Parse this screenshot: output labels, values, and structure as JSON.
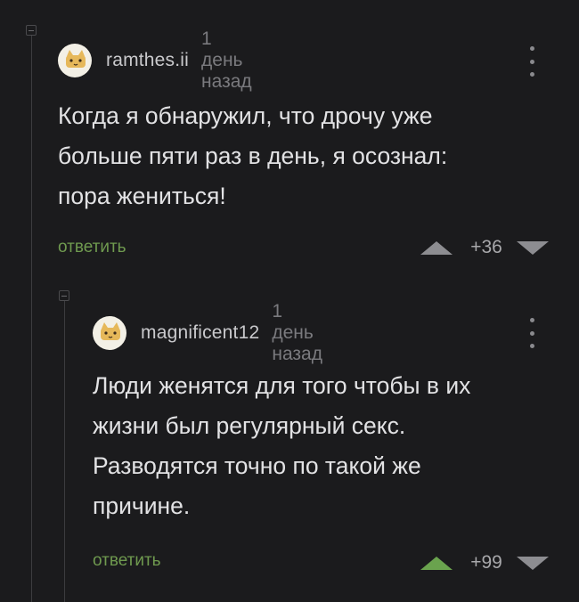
{
  "comments": [
    {
      "username": "ramthes.ii",
      "time": "1 день назад",
      "text_lines": [
        "Когда я обнаружил, что дрочу уже",
        "больше пяти раз в день, я осознал:",
        "пора жениться!"
      ],
      "reply_label": "ответить",
      "score": "+36",
      "voted_up": false,
      "avatar_icon": "cat-face-icon"
    },
    {
      "username": "magnificent12",
      "time": "1 день назад",
      "text_lines": [
        "Люди женятся для того чтобы в их",
        "жизни был регулярный секс.",
        "Разводятся точно по такой же",
        "причине."
      ],
      "reply_label": "ответить",
      "score": "+99",
      "voted_up": true,
      "avatar_icon": "cat-face-icon"
    }
  ],
  "colors": {
    "background": "#1b1b1d",
    "reply": "#6f9a4f",
    "upvote_active": "#6aa34e",
    "muted": "#7a7a7e"
  }
}
